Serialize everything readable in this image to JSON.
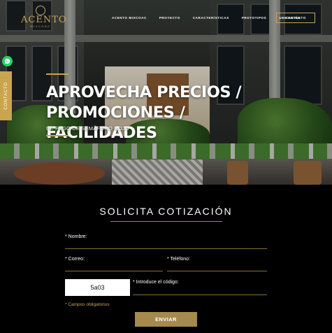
{
  "brand": {
    "name": "ACENTO",
    "sub": "MIXCOAC"
  },
  "nav": {
    "items": [
      "ACENTO MIXCOAC",
      "PROYECTO",
      "CARACTERÍSTICAS",
      "PROTOTIPOS",
      "UBICACIÓN"
    ],
    "contact": "CONTACTO"
  },
  "side_tab": "CONTACTO",
  "hero": {
    "title_line1": "APROVECHA PRECIOS /",
    "title_line2": "PROMOCIONES / FACILIDADES",
    "subtitle": "DE PAGO DE SEMÁFORO ROJO"
  },
  "form": {
    "title": "SOLICITA COTIZACIÓN",
    "name_label": "* Nombre:",
    "email_label": "* Correo:",
    "phone_label": "* Teléfono:",
    "captcha_value": "5a03",
    "code_label": "* Introduce el código:",
    "required_note": "* Campos obligatorios",
    "submit": "ENVIAR"
  },
  "colors": {
    "accent": "#c9a550",
    "whatsapp": "#25d366",
    "background": "#000000"
  },
  "icons": {
    "whatsapp": "whatsapp-icon",
    "logo": "logo-ring-icon"
  }
}
